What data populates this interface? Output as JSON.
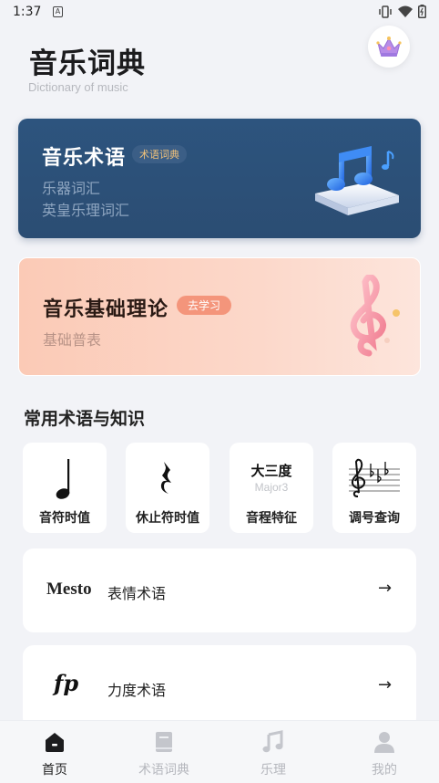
{
  "status_bar": {
    "time": "1:37",
    "notification_letter": "A"
  },
  "header": {
    "title": "音乐词典",
    "subtitle": "Dictionary of music"
  },
  "card_terms": {
    "title": "音乐术语",
    "badge": "术语词典",
    "lines": [
      "乐器词汇",
      "英皇乐理词汇"
    ]
  },
  "card_theory": {
    "title": "音乐基础理论",
    "badge": "去学习",
    "line": "基础普表"
  },
  "section": {
    "title": "常用术语与知识"
  },
  "tiles": [
    {
      "label": "音符时值",
      "icon": "quarter-note-icon"
    },
    {
      "label": "休止符时值",
      "icon": "quarter-rest-icon"
    },
    {
      "label": "音程特征",
      "top": "大三度",
      "bottom": "Major3"
    },
    {
      "label": "调号查询",
      "icon": "key-signature-icon"
    }
  ],
  "rows": [
    {
      "symbol": "Mesto",
      "label": "表情术语",
      "arrow": "→"
    },
    {
      "symbol": "fp",
      "label": "力度术语",
      "arrow": "→"
    }
  ],
  "bottom_nav": [
    {
      "label": "首页",
      "icon": "home-icon",
      "active": true
    },
    {
      "label": "术语词典",
      "icon": "book-icon",
      "active": false
    },
    {
      "label": "乐理",
      "icon": "music-note-icon",
      "active": false
    },
    {
      "label": "我的",
      "icon": "user-icon",
      "active": false
    }
  ],
  "colors": {
    "terms_card": "#2d547e",
    "theory_card": "#fbcab6",
    "accent_badge": "#f4957b",
    "background": "#f2f3f7"
  }
}
